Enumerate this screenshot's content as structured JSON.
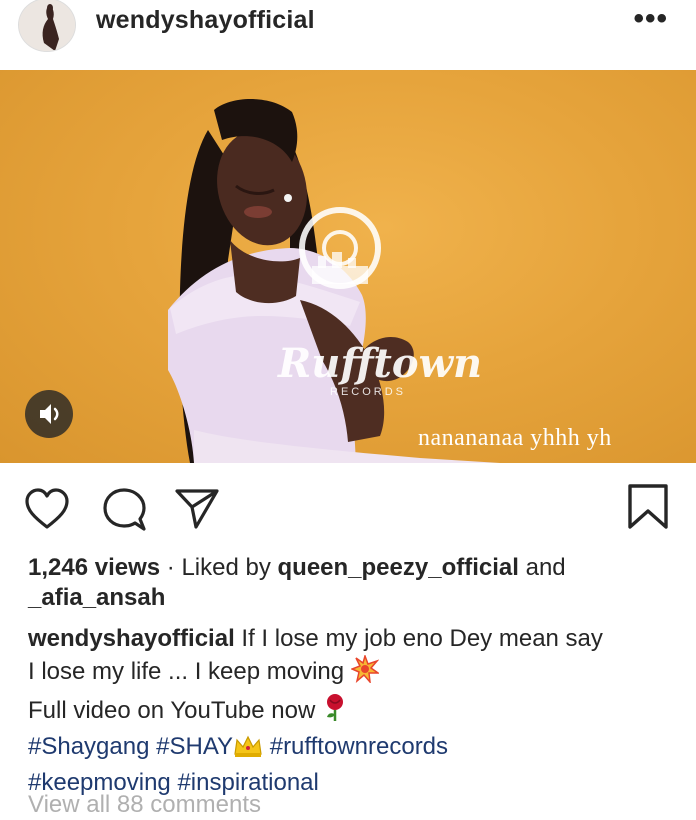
{
  "post": {
    "username": "wendyshayofficial",
    "more_glyph": "•••"
  },
  "media": {
    "watermark_brand": "Rufftown",
    "watermark_sub": "RECORDS",
    "subtitle_text": "nanananaa yhhh yh",
    "background_color": "#e6a43c"
  },
  "actions": {
    "like_icon": "heart-icon",
    "comment_icon": "comment-icon",
    "share_icon": "share-icon",
    "save_icon": "bookmark-icon"
  },
  "stats": {
    "views": "1,246 views",
    "separator": " · Liked by ",
    "liker_1": "queen_peezy_official",
    "and": " and",
    "liker_2": "_afia_ansah"
  },
  "caption": {
    "username": "wendyshayofficial",
    "line1": " If I lose my job eno Dey mean say",
    "line2": "I lose my life ... I keep moving ",
    "line3": "Full video on YouTube now ",
    "tag1": "#Shaygang",
    "tag2": "#SHAY",
    "tag3": "#rufftownrecords",
    "tag4": "#keepmoving",
    "tag5": "#inspirational"
  },
  "comments": {
    "view_all": "View all 88 comments"
  }
}
